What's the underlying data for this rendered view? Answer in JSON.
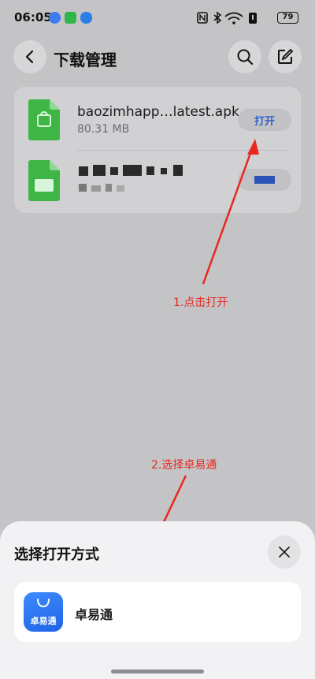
{
  "status_bar": {
    "time": "06:05",
    "battery": "79",
    "left_icons": [
      "browser-icon",
      "tv-app-icon",
      "security-app-icon"
    ],
    "right_icons": [
      "nfc-icon",
      "bluetooth-icon",
      "wifi-icon",
      "battery-saver-icon",
      "battery-icon"
    ]
  },
  "header": {
    "title": "下载管理",
    "back_icon": "back-arrow-icon",
    "search_icon": "search-icon",
    "edit_icon": "edit-icon"
  },
  "downloads": [
    {
      "name": "baozimhapp…latest.apk",
      "size": "80.31 MB",
      "action": "打开",
      "icon": "apk-file-icon"
    },
    {
      "name": "",
      "size": "",
      "action": "",
      "icon": "archive-file-icon",
      "redacted": true
    }
  ],
  "annotations": {
    "step1": "1.点击打开",
    "step2": "2.选择卓易通"
  },
  "sheet": {
    "title": "选择打开方式",
    "close_icon": "close-icon",
    "apps": [
      {
        "name": "卓易通",
        "icon_label": "卓易通",
        "icon": "zhuoyitong-app-icon"
      }
    ]
  },
  "colors": {
    "accent": "#2f5fd0",
    "annotation": "#e8281e",
    "file_green": "#3fb545",
    "app_icon_blue": "#2b74f0"
  }
}
